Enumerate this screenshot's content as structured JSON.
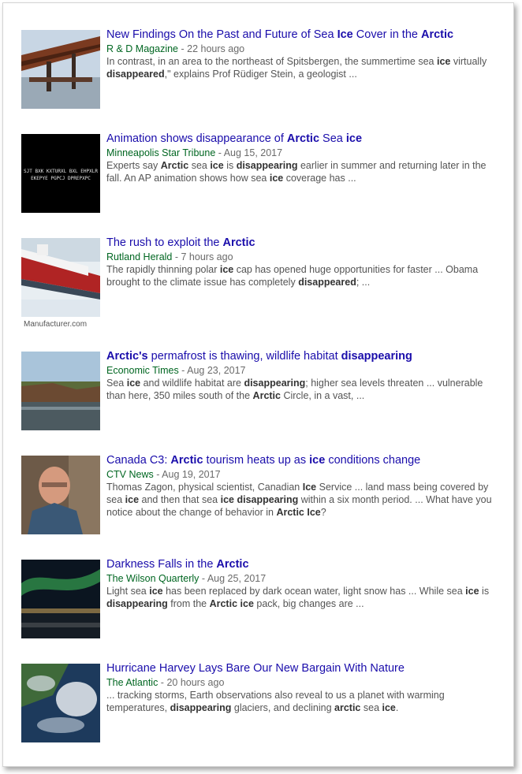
{
  "results": [
    {
      "title": [
        [
          "New Findings On the Past and Future of Sea ",
          false
        ],
        [
          "Ice",
          true
        ],
        [
          " Cover in the ",
          false
        ],
        [
          "Arctic",
          true
        ]
      ],
      "source": "R & D Magazine",
      "time": "22 hours ago",
      "snippet": [
        [
          "In contrast, in an area to the northeast of Spitsbergen, the summertime sea ",
          false
        ],
        [
          "ice",
          true
        ],
        [
          " virtually ",
          false
        ],
        [
          "disappeared",
          true
        ],
        [
          ",\" explains Prof Rüdiger Stein, a geologist ...",
          false
        ]
      ],
      "image": "ship-crane-icon",
      "caption": ""
    },
    {
      "title": [
        [
          "Animation shows disappearance of ",
          false
        ],
        [
          "Arctic",
          true
        ],
        [
          " Sea ",
          false
        ],
        [
          "ice",
          true
        ]
      ],
      "source": "Minneapolis Star Tribune",
      "time": "Aug 15, 2017",
      "snippet": [
        [
          "Experts say ",
          false
        ],
        [
          "Arctic",
          true
        ],
        [
          " sea ",
          false
        ],
        [
          "ice",
          true
        ],
        [
          " is ",
          false
        ],
        [
          "disappearing",
          true
        ],
        [
          " earlier in summer and returning later in the fall. An AP animation shows how sea ",
          false
        ],
        [
          "ice",
          true
        ],
        [
          " coverage has ...",
          false
        ]
      ],
      "image": "video-still-icon",
      "caption": ""
    },
    {
      "title": [
        [
          "The rush to exploit the ",
          false
        ],
        [
          "Arctic",
          true
        ]
      ],
      "source": "Rutland Herald",
      "time": "7 hours ago",
      "snippet": [
        [
          "The rapidly thinning polar ",
          false
        ],
        [
          "ice",
          true
        ],
        [
          " cap has opened huge opportunities for faster ... Obama brought to the climate issue has completely ",
          false
        ],
        [
          "disappeared",
          true
        ],
        [
          "; ...",
          false
        ]
      ],
      "image": "icebreaker-ship-icon",
      "caption": "Manufacturer.com"
    },
    {
      "title": [
        [
          "Arctic's",
          true
        ],
        [
          " permafrost is thawing, wildlife habitat ",
          false
        ],
        [
          "disappearing",
          true
        ]
      ],
      "source": "Economic Times",
      "time": "Aug 23, 2017",
      "snippet": [
        [
          "Sea ",
          false
        ],
        [
          "ice",
          true
        ],
        [
          " and wildlife habitat are ",
          false
        ],
        [
          "disappearing",
          true
        ],
        [
          "; higher sea levels threaten ... vulnerable than here, 350 miles south of the ",
          false
        ],
        [
          "Arctic",
          true
        ],
        [
          " Circle, in a vast, ...",
          false
        ]
      ],
      "image": "permafrost-landscape-icon",
      "caption": ""
    },
    {
      "title": [
        [
          "Canada C3: ",
          false
        ],
        [
          "Arctic",
          true
        ],
        [
          " tourism heats up as ",
          false
        ],
        [
          "ice",
          true
        ],
        [
          " conditions change",
          false
        ]
      ],
      "source": "CTV News",
      "time": "Aug 19, 2017",
      "snippet": [
        [
          "Thomas Zagon, physical scientist, Canadian ",
          false
        ],
        [
          "Ice",
          true
        ],
        [
          " Service ... land mass being covered by sea ",
          false
        ],
        [
          "ice",
          true
        ],
        [
          " and then that sea ",
          false
        ],
        [
          "ice",
          true
        ],
        [
          " ",
          false
        ],
        [
          "disappearing",
          true
        ],
        [
          " within a six month period. ... What have you notice about the change of behavior in ",
          false
        ],
        [
          "Arctic Ice",
          true
        ],
        [
          "?",
          false
        ]
      ],
      "image": "portrait-photo-icon",
      "caption": ""
    },
    {
      "title": [
        [
          "Darkness Falls in the ",
          false
        ],
        [
          "Arctic",
          true
        ]
      ],
      "source": "The Wilson Quarterly",
      "time": "Aug 25, 2017",
      "snippet": [
        [
          "Light sea ",
          false
        ],
        [
          "ice",
          true
        ],
        [
          " has been replaced by dark ocean water, light snow has ... While sea ",
          false
        ],
        [
          "ice",
          true
        ],
        [
          " is ",
          false
        ],
        [
          "disappearing",
          true
        ],
        [
          " from the ",
          false
        ],
        [
          "Arctic",
          true
        ],
        [
          " ",
          false
        ],
        [
          "ice",
          true
        ],
        [
          " pack, big changes are ...",
          false
        ]
      ],
      "image": "aurora-night-icon",
      "caption": ""
    },
    {
      "title": [
        [
          "Hurricane Harvey Lays Bare Our New Bargain With Nature",
          false
        ]
      ],
      "source": "The Atlantic",
      "time": "20 hours ago",
      "snippet": [
        [
          "... tracking storms, Earth observations also reveal to us a planet with warming temperatures, ",
          false
        ],
        [
          "disappearing",
          true
        ],
        [
          " glaciers, and declining ",
          false
        ],
        [
          "arctic",
          true
        ],
        [
          " sea ",
          false
        ],
        [
          "ice",
          true
        ],
        [
          ".",
          false
        ]
      ],
      "image": "satellite-storm-icon",
      "caption": ""
    }
  ],
  "video_still_text": [
    "SJT BXK KXTURXL BXL EHPXLR",
    "EKEPYE PGPCJ DPREPXPC"
  ],
  "separator": " - "
}
